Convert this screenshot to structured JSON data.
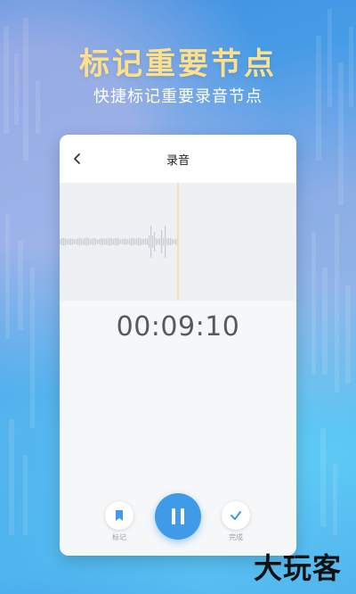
{
  "hero": {
    "title": "标记重要节点",
    "subtitle": "快捷标记重要录音节点"
  },
  "app": {
    "title": "录音",
    "back_icon": "chevron-left-icon",
    "timer": "00:09:10"
  },
  "controls": {
    "mark_label": "标记",
    "mark_icon": "bookmark-icon",
    "pause_icon": "pause-icon",
    "done_label": "完成",
    "done_icon": "check-icon"
  },
  "watermark": "大玩客",
  "colors": {
    "hero_title": "#ffe08a",
    "accent": "#3f9ae8",
    "playhead": "#f3dca0"
  }
}
